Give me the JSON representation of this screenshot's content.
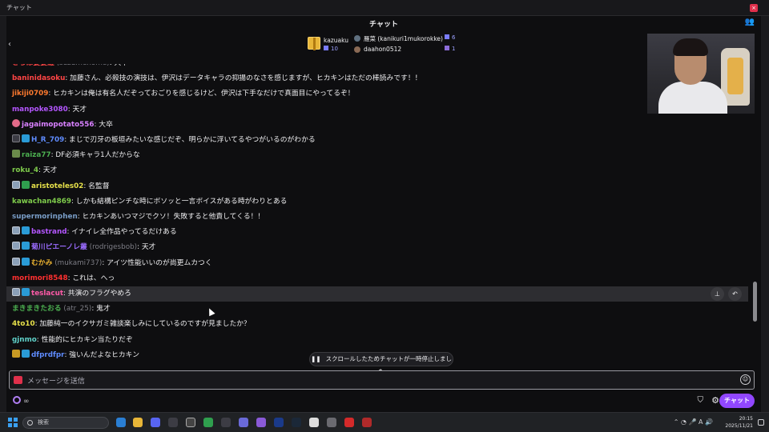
{
  "window": {
    "title": "チャット",
    "close": "×"
  },
  "header": {
    "title": "チャット",
    "community_icon": "person-plus-icon"
  },
  "leaderboard": {
    "prev": "‹",
    "next": "›",
    "first": {
      "name": "kazuaku",
      "count": "10"
    },
    "second": {
      "name": "雁菜 (kanikuri1mukorokke)",
      "count": "6"
    },
    "third": {
      "name": "daahon0512",
      "count": "1"
    }
  },
  "messages": [
    {
      "user": "さらば婆婆羅",
      "sub": "(suzumenome)",
      "text": ": 大卒",
      "color": "#ff4545",
      "badges": []
    },
    {
      "user": "baninidasoku",
      "sub": "",
      "text": ": 加藤さん、必殺技の演技は、伊沢はデータキャラの抑揚のなさを感じますが、ヒカキンはただの棒読みです！！",
      "color": "#ff4545",
      "badges": []
    },
    {
      "user": "jikiji0709",
      "sub": "",
      "text": ": ヒカキンは俺は有名人だぞっておごりを感じるけど、伊沢は下手なだけで真面目にやってるぞ！",
      "color": "#ff7a2f",
      "badges": []
    },
    {
      "user": "manpoke3080",
      "sub": "",
      "text": ": 天才",
      "color": "#b456ff",
      "badges": []
    },
    {
      "user": "jagaimopotato556",
      "sub": "",
      "text": ": 大卒",
      "color": "#d880ff",
      "badges": [
        "b-heart"
      ]
    },
    {
      "user": "H_R_709",
      "sub": "",
      "text": ": まじで刃牙の板垣みたいな感じだぞ、明らかに浮いてるやつがいるのがわかる",
      "color": "#5f8cff",
      "badges": [
        "b-dark",
        "b-prime"
      ]
    },
    {
      "user": "raiza77",
      "sub": "",
      "text": ": DF必須キャラ1人だからな",
      "color": "#4caf50",
      "badges": [
        "b-gold"
      ]
    },
    {
      "user": "roku_4",
      "sub": "",
      "text": ": 天才",
      "color": "#7ecb4b",
      "badges": []
    },
    {
      "user": "aristoteles02",
      "sub": "",
      "text": ": 名監督",
      "color": "#e6e04a",
      "badges": [
        "b-sub",
        "b-green"
      ]
    },
    {
      "user": "kawachan4869",
      "sub": "",
      "text": ": しかも結構ピンチな時にボソッと一言ボイスがある時がわりとある",
      "color": "#7ecb4b",
      "badges": []
    },
    {
      "user": "supermorinphen",
      "sub": "",
      "text": ": ヒカキンあいつマジでクソ！失敗すると他責してくる！！",
      "color": "#7a9ec8",
      "badges": []
    },
    {
      "user": "bastrand",
      "sub": "",
      "text": ": イナイレ全作品やってるだけある",
      "color": "#b456ff",
      "badges": [
        "b-sub",
        "b-prime"
      ]
    },
    {
      "user": "菊川ピエーノレ叢",
      "sub": "(rodrigesbob)",
      "text": ": 天才",
      "color": "#9b6cff",
      "badges": [
        "b-sub",
        "b-prime"
      ]
    },
    {
      "user": "むかみ",
      "sub": "(mukami737)",
      "text": ": アイツ性能いいのが尚更ムカつく",
      "color": "#e8b030",
      "badges": [
        "b-sub",
        "b-prime"
      ]
    },
    {
      "user": "morimori8548",
      "sub": "",
      "text": ": これは、へっ",
      "color": "#ff3030",
      "badges": []
    },
    {
      "user": "teslacut",
      "sub": "",
      "text": ": 共演のフラグやめろ",
      "color": "#ff5aa8",
      "badges": [
        "b-sub",
        "b-prime"
      ]
    },
    {
      "user": "まきまきたおる",
      "sub": "(atr_25)",
      "text": ": 鬼才",
      "color": "#4caf50",
      "badges": []
    },
    {
      "user": "4to10",
      "sub": "",
      "text": ": 加藤純一のイクサガミ雑談楽しみにしているのですが見ましたか？",
      "color": "#e6e04a",
      "badges": []
    },
    {
      "user": "gjnmo",
      "sub": "",
      "text": ": 性能的にヒカキン当たりだぞ",
      "color": "#5fd0c8",
      "badges": []
    },
    {
      "user": "dfprdfpr",
      "sub": "",
      "text": ": 強いんだよなヒカキン",
      "color": "#5f8cff",
      "badges": [
        "b-yellow",
        "b-prime"
      ]
    }
  ],
  "paused_notice": "スクロールしたためチャットが一時停止しました",
  "input": {
    "placeholder": "メッセージを送信"
  },
  "bottom": {
    "points": "∞",
    "chat_button": "チャット"
  },
  "taskbar": {
    "search": "検索",
    "time": "20:15",
    "date": "2025/11/21"
  }
}
